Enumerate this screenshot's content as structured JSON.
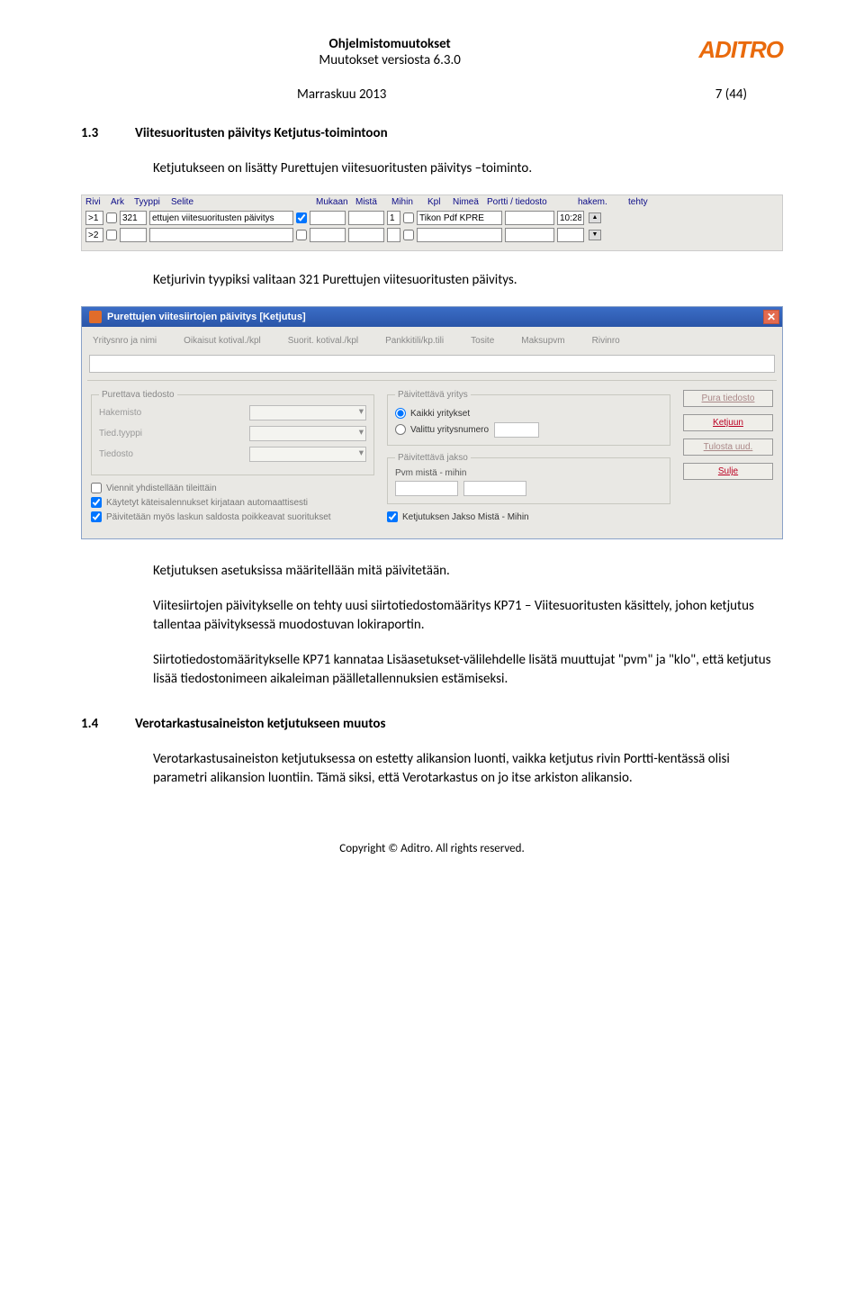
{
  "header": {
    "title1": "Ohjelmistomuutokset",
    "title2": "Muutokset versiosta 6.3.0",
    "logo": "ADITRO"
  },
  "dateline": {
    "date": "Marraskuu 2013",
    "page": "7 (44)"
  },
  "s13": {
    "num": "1.3",
    "title": "Viitesuoritusten päivitys Ketjutus-toimintoon",
    "p1": "Ketjutukseen on lisätty Purettujen viitesuoritusten päivitys –toiminto.",
    "p2": "Ketjurivin tyypiksi valitaan 321 Purettujen viitesuoritusten päivitys.",
    "p3": "Ketjutuksen asetuksissa määritellään mitä päivitetään.",
    "p4": "Viitesiirtojen päivitykselle on tehty uusi siirtotiedostomääritys KP71 – Viitesuoritusten käsittely, johon ketjutus tallentaa päivityksessä muodostuvan lokiraportin.",
    "p5": "Siirtotiedostomääritykselle KP71 kannataa Lisäasetukset-välilehdelle lisätä muuttujat \"pvm\" ja \"klo\", että ketjutus lisää tiedostonimeen aikaleiman päälletallennuksien estämiseksi."
  },
  "s14": {
    "num": "1.4",
    "title": "Verotarkastusaineiston ketjutukseen muutos",
    "p1": "Verotarkastusaineiston ketjutuksessa on estetty alikansion luonti, vaikka ketjutus rivin Portti-kentässä olisi parametri alikansion luontiin. Tämä siksi, että Verotarkastus on jo itse arkiston alikansio."
  },
  "shot1": {
    "headers": [
      "Rivi",
      "Ark",
      "Tyyppi",
      "Selite",
      "Mukaan",
      "Mistä",
      "Mihin",
      "Kpl",
      "Nimeä",
      "Portti / tiedosto",
      "hakem.",
      "tehty"
    ],
    "row1": {
      "rivi": ">1",
      "tyyppi": "321",
      "selite": "ettujen viitesuoritusten päivitys",
      "mukaan": true,
      "kpl": "1",
      "nimea": false,
      "portti": "Tikon Pdf KPRE",
      "tehty": "10:28"
    },
    "row2": {
      "rivi": ">2"
    }
  },
  "shot2": {
    "title": "Purettujen viitesiirtojen päivitys [Ketjutus]",
    "headrow": [
      "Yritysnro ja nimi",
      "Oikaisut kotival./kpl",
      "Suorit. kotival./kpl",
      "Pankkitili/kp.tili",
      "Tosite",
      "Maksupvm",
      "Rivinro"
    ],
    "fs1": {
      "legend": "Purettava tiedosto",
      "l1": "Hakemisto",
      "l2": "Tied.tyyppi",
      "l3": "Tiedosto"
    },
    "cb1": "Viennit yhdistellään tileittäin",
    "cb2": "Käytetyt käteisalennukset kirjataan automaattisesti",
    "cb3": "Päivitetään myös laskun saldosta poikkeavat suoritukset",
    "fs2": {
      "legend": "Päivitettävä yritys",
      "r1": "Kaikki yritykset",
      "r2": "Valittu yritysnumero"
    },
    "fs3": {
      "legend": "Päivitettävä jakso",
      "l1": "Pvm mistä - mihin"
    },
    "cb4": "Ketjutuksen Jakso Mistä - Mihin",
    "btns": {
      "b1": "Pura tiedosto",
      "b2": "Ketjuun",
      "b3": "Tulosta uud.",
      "b4": "Sulje"
    }
  },
  "footer": "Copyright © Aditro. All rights reserved."
}
